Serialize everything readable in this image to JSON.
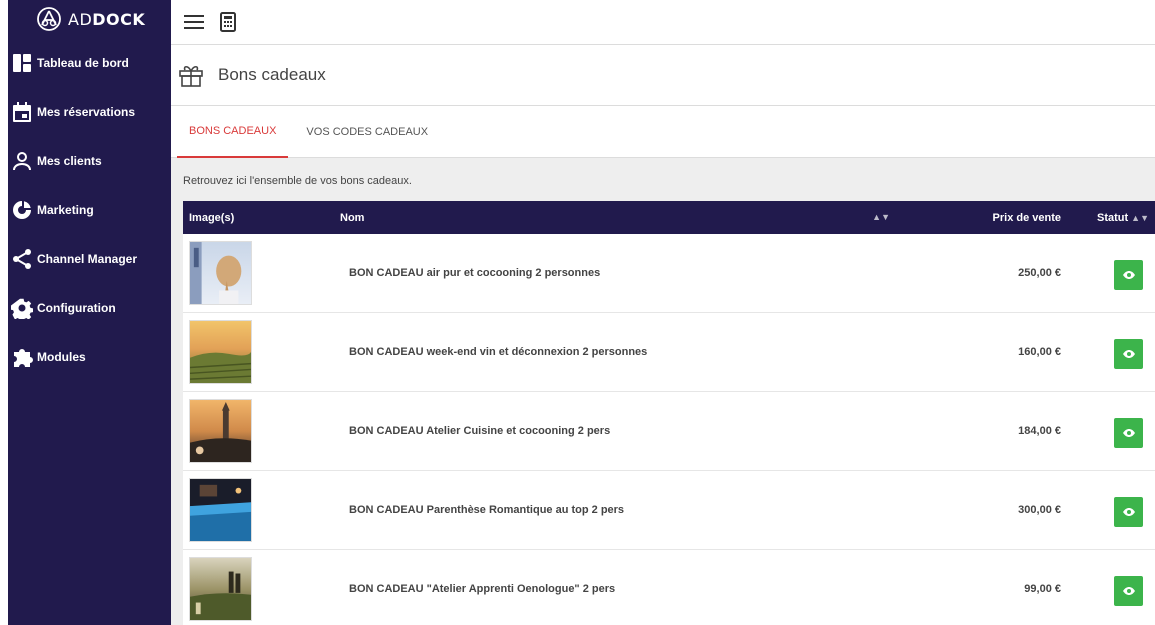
{
  "brand": {
    "name_light": "AD",
    "name_bold": "DOCK"
  },
  "sidebar": {
    "items": [
      {
        "label": "Tableau de bord",
        "icon": "dashboard-icon"
      },
      {
        "label": "Mes réservations",
        "icon": "calendar-icon"
      },
      {
        "label": "Mes clients",
        "icon": "user-icon"
      },
      {
        "label": "Marketing",
        "icon": "marketing-icon"
      },
      {
        "label": "Channel Manager",
        "icon": "share-icon"
      },
      {
        "label": "Configuration",
        "icon": "gear-icon"
      },
      {
        "label": "Modules",
        "icon": "puzzle-icon"
      }
    ]
  },
  "topbar": {
    "menu_icon": "hamburger-icon",
    "calc_icon": "calculator-icon"
  },
  "header": {
    "title": "Bons cadeaux",
    "icon": "gift-icon"
  },
  "tabs": [
    {
      "label": "BONS CADEAUX",
      "active": true
    },
    {
      "label": "VOS CODES CADEAUX",
      "active": false
    }
  ],
  "intro": "Retrouvez ici l'ensemble de vos bons cadeaux.",
  "table": {
    "columns": {
      "image": "Image(s)",
      "name": "Nom",
      "price": "Prix de vente",
      "status": "Statut"
    },
    "rows": [
      {
        "name": "BON CADEAU air pur et cocooning 2 personnes",
        "price": "250,00 €"
      },
      {
        "name": "BON CADEAU week-end vin et déconnexion 2 personnes",
        "price": "160,00 €"
      },
      {
        "name": "BON CADEAU Atelier Cuisine et cocooning 2 pers",
        "price": "184,00 €"
      },
      {
        "name": "BON CADEAU Parenthèse Romantique au top 2 pers",
        "price": "300,00 €"
      },
      {
        "name": "BON CADEAU \"Atelier Apprenti Oenologue\" 2 pers",
        "price": "99,00 €"
      }
    ]
  },
  "colors": {
    "sidebar": "#211a4d",
    "accent": "#d93a3a",
    "status": "#3cb44b"
  }
}
